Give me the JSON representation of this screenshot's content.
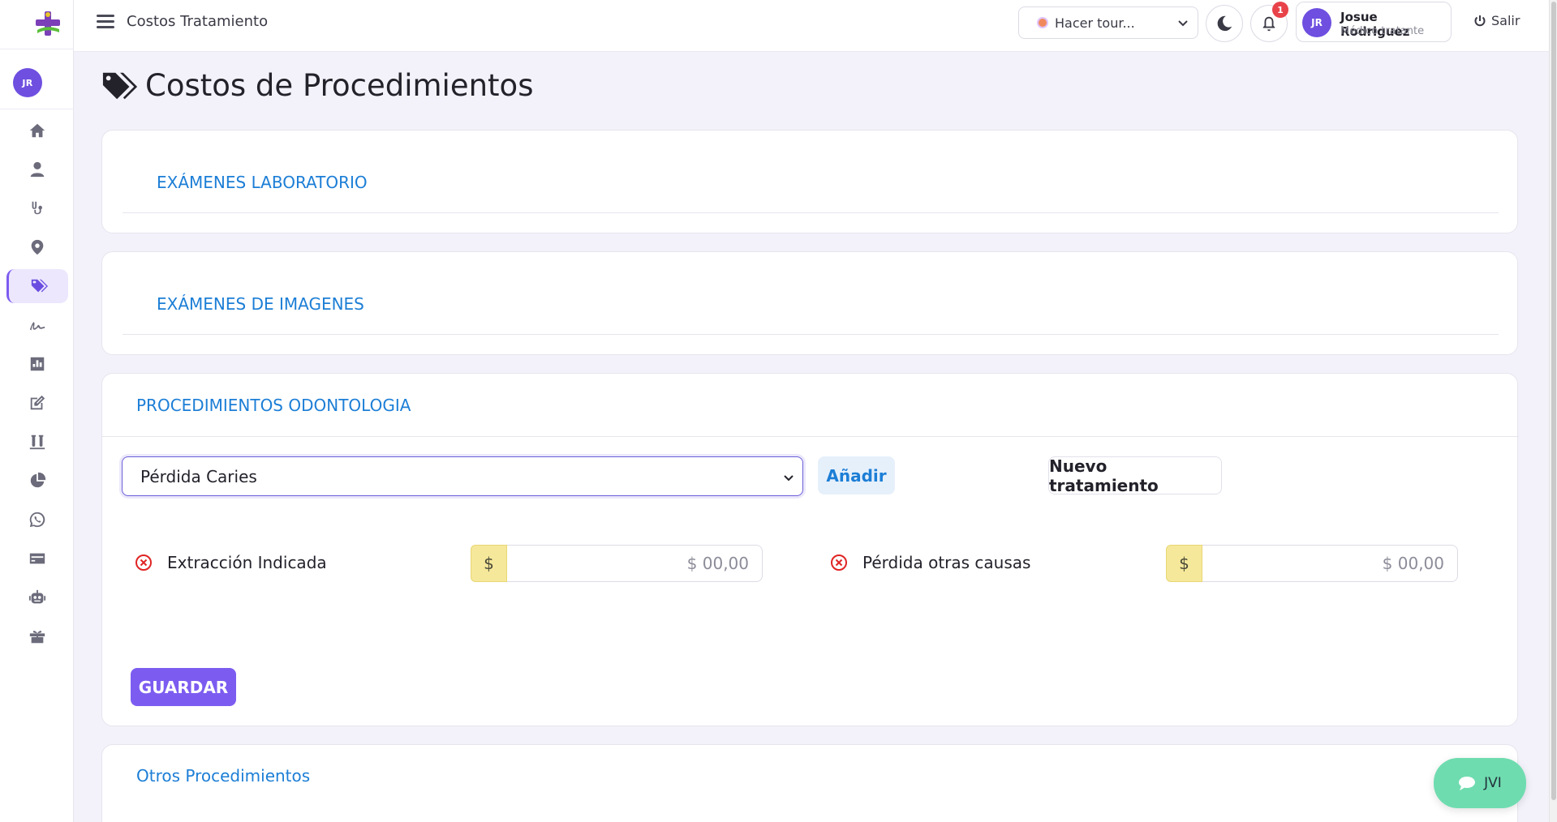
{
  "sidebar": {
    "user_initials": "JR",
    "items": [
      {
        "icon": "home-icon"
      },
      {
        "icon": "user-icon"
      },
      {
        "icon": "stethoscope-icon"
      },
      {
        "icon": "location-pin-icon"
      },
      {
        "icon": "tags-icon",
        "active": true
      },
      {
        "icon": "signature-icon"
      },
      {
        "icon": "bar-chart-icon"
      },
      {
        "icon": "edit-icon"
      },
      {
        "icon": "test-tubes-icon"
      },
      {
        "icon": "pie-chart-icon"
      },
      {
        "icon": "whatsapp-icon"
      },
      {
        "icon": "credit-card-icon"
      },
      {
        "icon": "robot-icon"
      },
      {
        "icon": "gift-icon"
      }
    ]
  },
  "topbar": {
    "title": "Costos Tratamiento",
    "tour_select": "Hacer tour...",
    "notifications_count": "1",
    "user": {
      "initials": "JR",
      "name": "Josue Rodriguez",
      "role": "Médico tratante"
    },
    "logout_label": "Salir"
  },
  "page": {
    "title": "Costos de Procedimientos",
    "sections": {
      "lab": "EXÁMENES LABORATORIO",
      "images": "EXÁMENES DE IMAGENES",
      "odonto": "PROCEDIMIENTOS ODONTOLOGIA",
      "others": "Otros Procedimientos"
    },
    "odonto": {
      "selected_treatment": "Pérdida Caries",
      "add_label": "Añadir",
      "new_label": "Nuevo tratamiento",
      "items": [
        {
          "label": "Extracción Indicada",
          "currency": "$",
          "placeholder": "$ 00,00"
        },
        {
          "label": "Pérdida otras causas",
          "currency": "$",
          "placeholder": "$ 00,00"
        }
      ],
      "save_label": "GUARDAR"
    }
  },
  "chat": {
    "label": "JVI"
  },
  "colors": {
    "accent": "#7c5cf0",
    "link": "#1c7ed6",
    "currency_bg": "#f6e89a",
    "chat": "#6fdcb0"
  }
}
